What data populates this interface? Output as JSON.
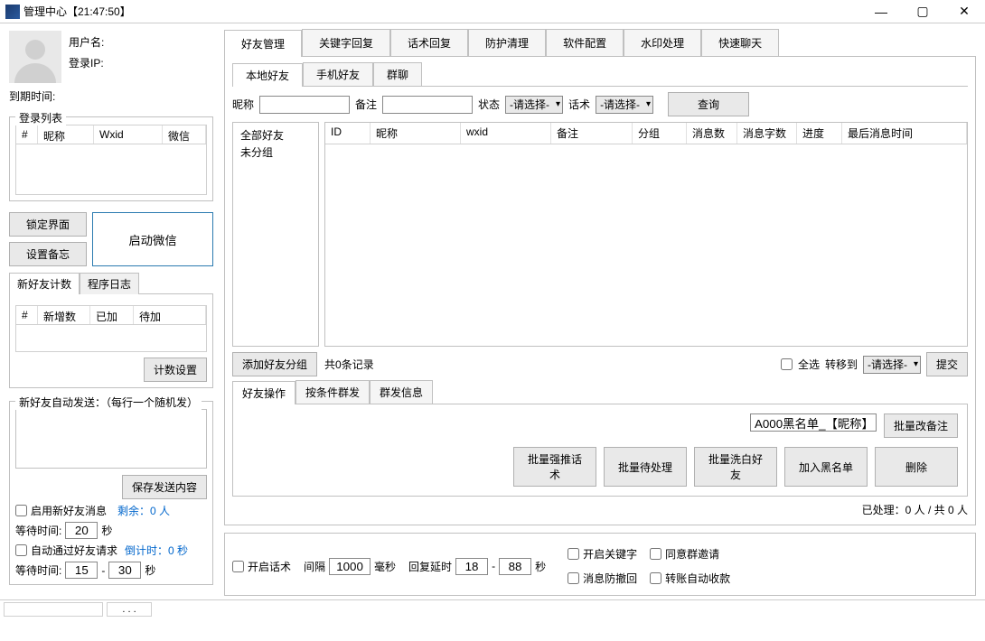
{
  "window": {
    "title": "管理中心【21:47:50】"
  },
  "user": {
    "name_label": "用户名:",
    "ip_label": "登录IP:",
    "expire_label": "到期时间:"
  },
  "login_list": {
    "legend": "登录列表",
    "cols": {
      "idx": "#",
      "nick": "昵称",
      "wxid": "Wxid",
      "wx": "微信"
    }
  },
  "left_buttons": {
    "lock": "锁定界面",
    "memo": "设置备忘",
    "start": "启动微信"
  },
  "count_tabs": {
    "new": "新好友计数",
    "log": "程序日志"
  },
  "count_cols": {
    "idx": "#",
    "add": "新增数",
    "done": "已加",
    "wait": "待加"
  },
  "count_setting_btn": "计数设置",
  "auto_send": {
    "legend": "新好友自动发送：（每行一个随机发）",
    "save_btn": "保存发送内容"
  },
  "opts": {
    "enable_new_msg": "启用新好友消息",
    "remain": "剩余：0 人",
    "wait_label": "等待时间:",
    "wait_val1": "20",
    "sec": "秒",
    "auto_pass": "自动通过好友请求",
    "countdown": "倒计时：0 秒",
    "wait_val2a": "15",
    "wait_val2b": "30"
  },
  "main_tabs": [
    "好友管理",
    "关键字回复",
    "话术回复",
    "防护清理",
    "软件配置",
    "水印处理",
    "快速聊天"
  ],
  "sub_tabs": [
    "本地好友",
    "手机好友",
    "群聊"
  ],
  "filter": {
    "nick": "昵称",
    "remark": "备注",
    "status": "状态",
    "script": "话术",
    "select_default": "-请选择- ",
    "query": "查询"
  },
  "tree": {
    "all": "全部好友",
    "ungroup": "未分组"
  },
  "grid_cols": [
    "ID",
    "昵称",
    "wxid",
    "备注",
    "分组",
    "消息数",
    "消息字数",
    "进度",
    "最后消息时间"
  ],
  "grid_footer": {
    "add_group": "添加好友分组",
    "records": "共0条记录",
    "select_all": "全选",
    "move_to": "转移到",
    "move_default": "-请选择- ",
    "submit": "提交"
  },
  "ops_tabs": [
    "好友操作",
    "按条件群发",
    "群发信息"
  ],
  "ops": {
    "blacklist_default": "A000黑名单_【昵称】",
    "batch_remark": "批量改备注",
    "batch_push": "批量强推话术",
    "batch_pending": "批量待处理",
    "batch_whiten": "批量洗白好友",
    "add_blacklist": "加入黑名单",
    "delete": "删除",
    "processed": "已处理：0 人 / 共 0 人"
  },
  "bottom": {
    "open_script": "开启话术",
    "interval": "间隔",
    "interval_val": "1000",
    "ms": "毫秒",
    "reply_delay": "回复延时",
    "delay_a": "18",
    "delay_b": "88",
    "sec": "秒",
    "open_keyword": "开启关键字",
    "agree_group": "同意群邀请",
    "anti_recall": "消息防撤回",
    "auto_collect": "转账自动收款"
  },
  "statusbar": {
    "dots": ". . ."
  }
}
